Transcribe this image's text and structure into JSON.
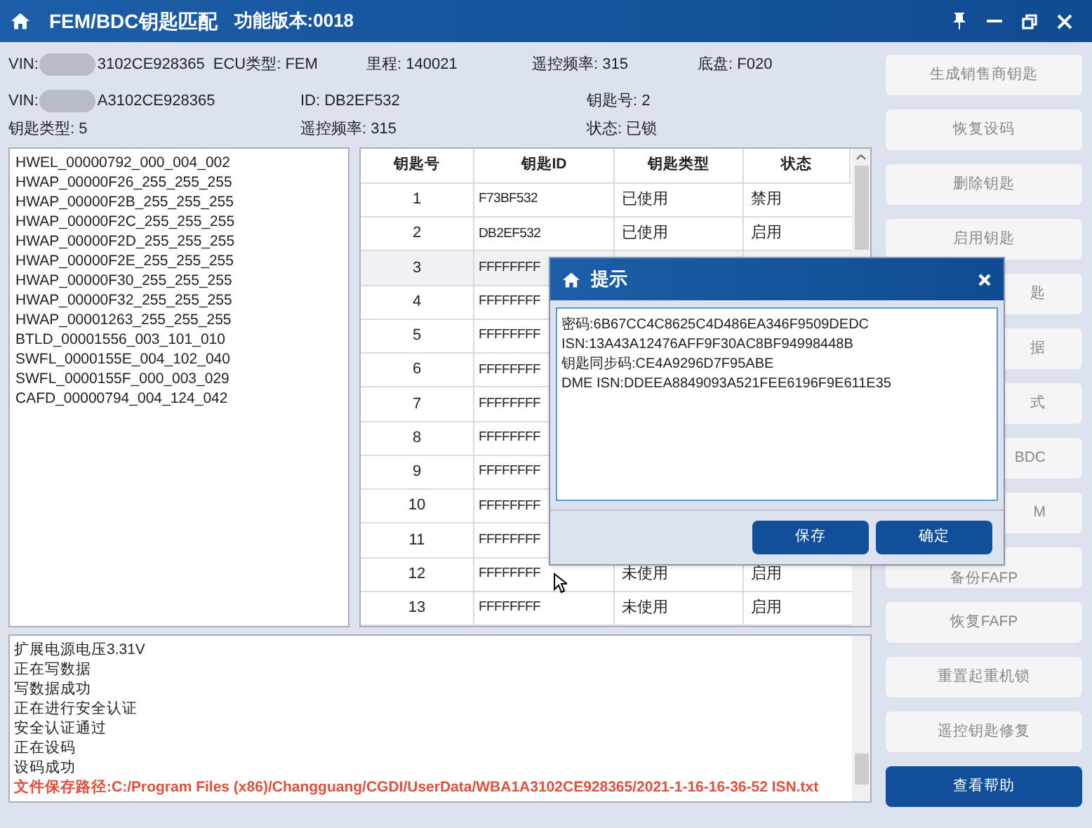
{
  "window": {
    "title": "FEM/BDC钥匙匹配",
    "version": "功能版本:0018"
  },
  "info_row1": {
    "vin_label": "VIN:",
    "vin_visible": "3102CE928365",
    "ecu": "ECU类型: FEM",
    "mileage": "里程: 140021",
    "remote_freq": "遥控频率: 315",
    "chassis": "底盘: F020"
  },
  "info_row2": {
    "vin_label": "VIN:",
    "vin_visible": "A3102CE928365",
    "id": "ID: DB2EF532",
    "key_no": "钥匙号: 2"
  },
  "info_row3": {
    "key_type": "钥匙类型: 5",
    "remote_freq": "遥控频率: 315",
    "status": "状态: 已锁"
  },
  "modules": [
    "HWEL_00000792_000_004_002",
    "HWAP_00000F26_255_255_255",
    "HWAP_00000F2B_255_255_255",
    "HWAP_00000F2C_255_255_255",
    "HWAP_00000F2D_255_255_255",
    "HWAP_00000F2E_255_255_255",
    "HWAP_00000F30_255_255_255",
    "HWAP_00000F32_255_255_255",
    "HWAP_00001263_255_255_255",
    "BTLD_00001556_003_101_010",
    "SWFL_0000155E_004_102_040",
    "SWFL_0000155F_000_003_029",
    "CAFD_00000794_004_124_042"
  ],
  "table": {
    "columns": [
      "钥匙号",
      "钥匙ID",
      "钥匙类型",
      "状态"
    ],
    "rows": [
      {
        "no": "1",
        "id": "F73BF532",
        "type": "已使用",
        "status": "禁用",
        "selected": false
      },
      {
        "no": "2",
        "id": "DB2EF532",
        "type": "已使用",
        "status": "启用",
        "selected": false
      },
      {
        "no": "3",
        "id": "FFFFFFFF",
        "selected": true
      },
      {
        "no": "4",
        "id": "FFFFFFFF",
        "selected": false
      },
      {
        "no": "5",
        "id": "FFFFFFFF",
        "selected": false
      },
      {
        "no": "6",
        "id": "FFFFFFFF",
        "selected": false
      },
      {
        "no": "7",
        "id": "FFFFFFFF",
        "selected": false
      },
      {
        "no": "8",
        "id": "FFFFFFFF",
        "selected": false
      },
      {
        "no": "9",
        "id": "FFFFFFFF",
        "selected": false
      },
      {
        "no": "10",
        "id": "FFFFFFFF",
        "selected": false
      },
      {
        "no": "11",
        "id": "FFFFFFFF",
        "selected": false
      },
      {
        "no": "12",
        "id": "FFFFFFFF",
        "type": "未使用",
        "status": "启用",
        "selected": false
      },
      {
        "no": "13",
        "id": "FFFFFFFF",
        "type": "未使用",
        "status": "启用",
        "selected": false
      }
    ]
  },
  "log": [
    {
      "text": "扩展电源电压3.31V",
      "kind": "normal"
    },
    {
      "text": "正在写数据",
      "kind": "normal"
    },
    {
      "text": "写数据成功",
      "kind": "normal"
    },
    {
      "text": "正在进行安全认证",
      "kind": "normal"
    },
    {
      "text": "安全认证通过",
      "kind": "normal"
    },
    {
      "text": "正在设码",
      "kind": "normal"
    },
    {
      "text": "设码成功",
      "kind": "normal"
    },
    {
      "text": "文件保存路径:C:/Program Files (x86)/Changguang/CGDI/UserData/WBA1A3102CE928365/2021-1-16-16-36-52 ISN.txt",
      "kind": "path"
    }
  ],
  "side_buttons": [
    {
      "label": "生成销售商钥匙",
      "kind": "full"
    },
    {
      "label": "恢复设码",
      "kind": "full"
    },
    {
      "label": "删除钥匙",
      "kind": "full"
    },
    {
      "label": "启用钥匙",
      "kind": "full"
    },
    {
      "label": "匙",
      "kind": "partial"
    },
    {
      "label": "据",
      "kind": "partial"
    },
    {
      "label": "式",
      "kind": "partial"
    },
    {
      "label": "BDC",
      "kind": "partial"
    },
    {
      "label": "M",
      "kind": "partial"
    },
    {
      "label": "备份FAFP",
      "kind": "low"
    },
    {
      "label": "恢复FAFP",
      "kind": "full"
    },
    {
      "label": "重置起重机锁",
      "kind": "full"
    },
    {
      "label": "遥控钥匙修复",
      "kind": "full"
    },
    {
      "label": "查看帮助",
      "kind": "primary"
    }
  ],
  "dialog": {
    "title": "提示",
    "lines": [
      "密码:6B67CC4C8625C4D486EA346F9509DEDC",
      "ISN:13A43A12476AFF9F30AC8BF94998448B",
      "钥匙同步码:CE4A9296D7F95ABE",
      "DME ISN:DDEEA8849093A521FEE6196F9E611E35"
    ],
    "buttons": [
      "保存",
      "确定"
    ]
  }
}
